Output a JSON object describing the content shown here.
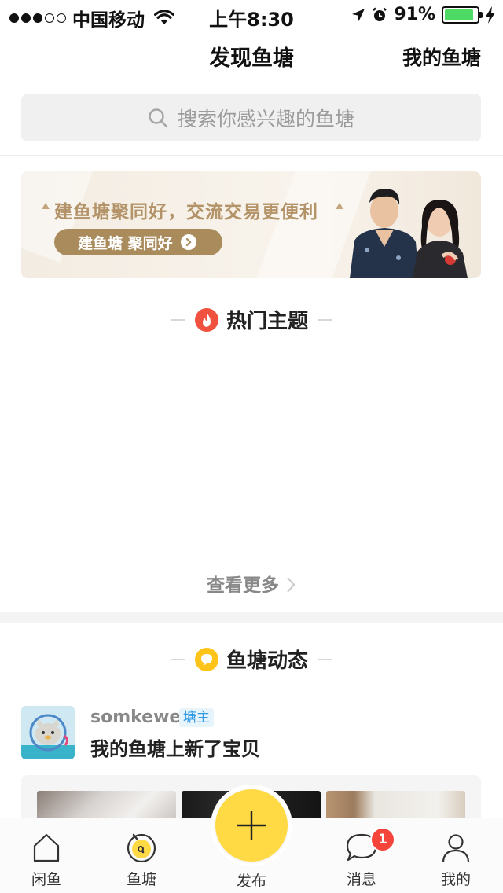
{
  "status_bar": {
    "carrier": "中国移动",
    "time": "上午8:30",
    "battery": "91%",
    "battery_level": 0.91
  },
  "nav": {
    "title": "发现鱼塘",
    "right_link": "我的鱼塘"
  },
  "search": {
    "placeholder": "搜索你感兴趣的鱼塘",
    "icon": "search-icon"
  },
  "banner": {
    "headline": "建鱼塘聚同好，交流交易更便利",
    "button_label": "建鱼塘 聚同好"
  },
  "hot_topics": {
    "title": "热门主题",
    "icon": "fire-icon",
    "see_more": "查看更多"
  },
  "pond_feed": {
    "title": "鱼塘动态",
    "icon": "chat-bubble-icon",
    "post": {
      "username": "somkewei",
      "badge": "塘主",
      "text": "我的鱼塘上新了宝贝"
    }
  },
  "tabbar": {
    "items": [
      {
        "label": "闲鱼",
        "icon": "home-icon"
      },
      {
        "label": "鱼塘",
        "icon": "pond-icon"
      },
      {
        "label": "发布",
        "icon": "plus-icon"
      },
      {
        "label": "消息",
        "icon": "message-icon",
        "badge": "1"
      },
      {
        "label": "我的",
        "icon": "person-icon"
      }
    ]
  },
  "colors": {
    "accent_yellow": "#ffda44",
    "badge_red": "#f5443a",
    "banner_gold": "#a98b5c",
    "hot_red": "#f0523f",
    "feed_yellow": "#ffc41a"
  }
}
